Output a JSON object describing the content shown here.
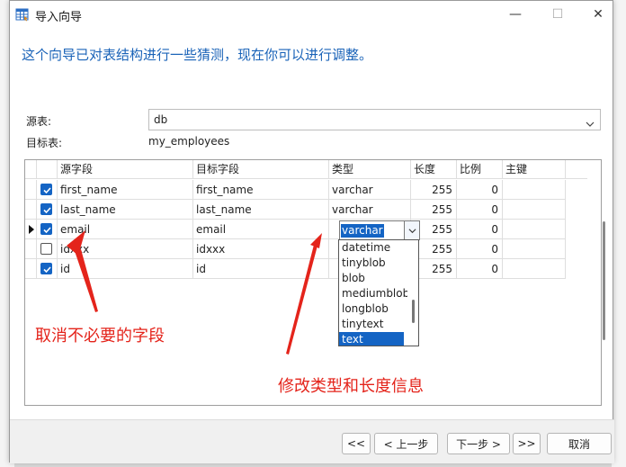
{
  "window": {
    "title": "导入向导",
    "min_glyph": "—",
    "max_glyph": "☐",
    "close_glyph": "✕"
  },
  "header": {
    "text": "这个向导已对表结构进行一些猜测，现在你可以进行调整。"
  },
  "source": {
    "label": "源表:",
    "value": "db"
  },
  "target": {
    "label": "目标表:",
    "value": "my_employees"
  },
  "grid": {
    "columns": [
      "源字段",
      "目标字段",
      "类型",
      "长度",
      "比例",
      "主键"
    ],
    "rows": [
      {
        "checked": true,
        "source": "first_name",
        "target": "first_name",
        "type": "varchar",
        "length": "255",
        "scale": "0",
        "pk": ""
      },
      {
        "checked": true,
        "source": "last_name",
        "target": "last_name",
        "type": "varchar",
        "length": "255",
        "scale": "0",
        "pk": ""
      },
      {
        "checked": true,
        "source": "email",
        "target": "email",
        "type": "varchar",
        "length": "255",
        "scale": "0",
        "pk": ""
      },
      {
        "checked": false,
        "source": "idxxx",
        "target": "idxxx",
        "type": "",
        "length": "255",
        "scale": "0",
        "pk": ""
      },
      {
        "checked": true,
        "source": "id",
        "target": "id",
        "type": "",
        "length": "255",
        "scale": "0",
        "pk": ""
      }
    ],
    "current_row_marker": "email"
  },
  "type_dropdown": {
    "options": [
      "datetime",
      "tinyblob",
      "blob",
      "mediumblob",
      "longblob",
      "tinytext",
      "text"
    ],
    "selected": "text"
  },
  "annotations": {
    "left": "取消不必要的字段",
    "right": "修改类型和长度信息",
    "color": "#e4241b"
  },
  "buttons": {
    "first": "<<",
    "prev": "< 上一步",
    "next": "下一步 >",
    "last": ">>",
    "cancel": "取消"
  },
  "colors": {
    "accent": "#1464c4",
    "header_text": "#1a63b8"
  }
}
